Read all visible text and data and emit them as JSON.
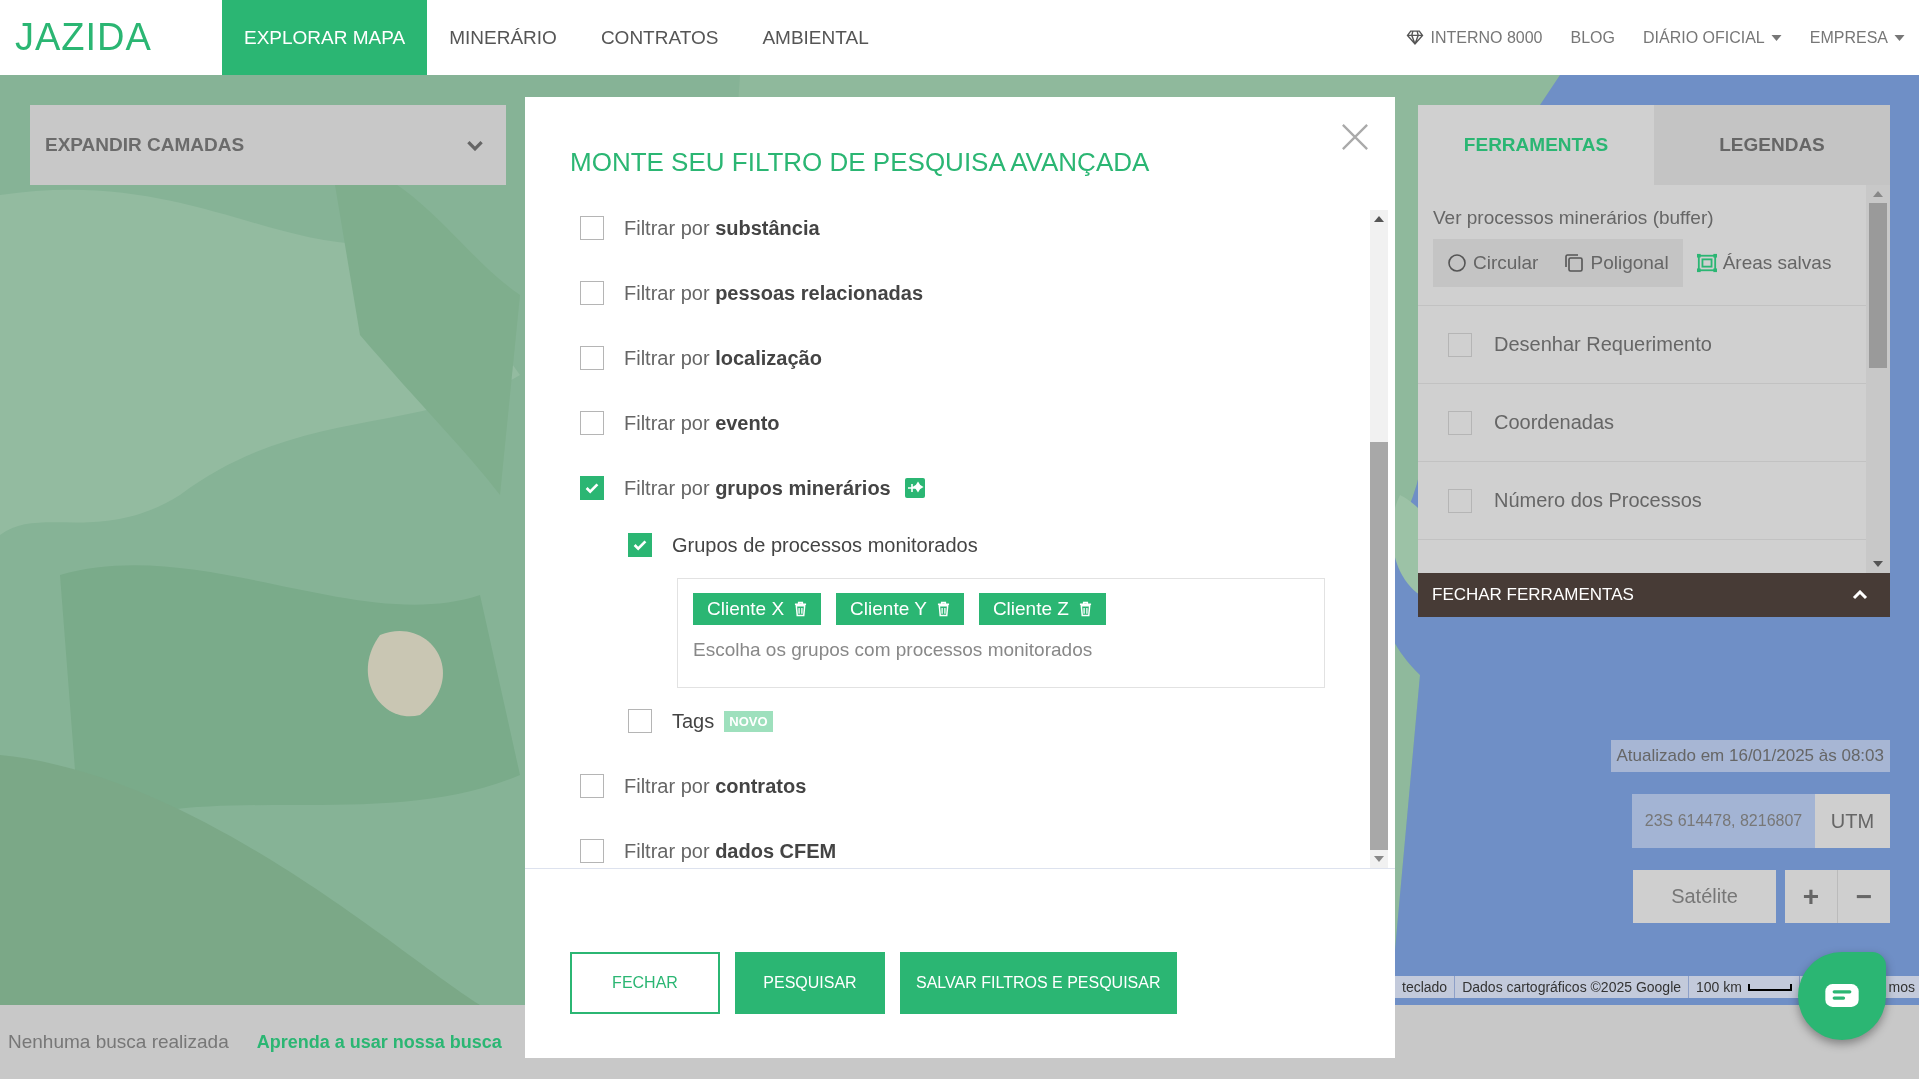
{
  "nav": {
    "logo": "JAZIDA",
    "tabs": [
      {
        "label": "EXPLORAR MAPA",
        "selected": true
      },
      {
        "label": "MINERÁRIO",
        "selected": false
      },
      {
        "label": "CONTRATOS",
        "selected": false
      },
      {
        "label": "AMBIENTAL",
        "selected": false
      }
    ],
    "links": [
      {
        "label": "INTERNO 8000",
        "kind": "plan"
      },
      {
        "label": "BLOG",
        "kind": "link"
      },
      {
        "label": "DIÁRIO OFICIAL",
        "kind": "dropdown"
      },
      {
        "label": "EMPRESA",
        "kind": "dropdown"
      }
    ]
  },
  "layers_panel": {
    "label": "EXPANDIR CAMADAS"
  },
  "tools_panel": {
    "tabs": [
      {
        "label": "FERRAMENTAS",
        "selected": true
      },
      {
        "label": "LEGENDAS",
        "selected": false
      }
    ],
    "heading": "Ver processos minerários (buffer)",
    "buffer_options": [
      {
        "label": "Circular",
        "kind": "circle"
      },
      {
        "label": "Poligonal",
        "kind": "polygon"
      },
      {
        "label": "Áreas salvas",
        "kind": "saved"
      }
    ],
    "options": [
      {
        "label": "Desenhar Requerimento",
        "checked": false
      },
      {
        "label": "Coordenadas",
        "checked": false
      },
      {
        "label": "Número dos Processos",
        "checked": false
      }
    ],
    "footer": "FECHAR FERRAMENTAS"
  },
  "map_controls": {
    "updated": "Atualizado em 16/01/2025 às 08:03",
    "coordinates": "23S 614478, 8216807",
    "coord_system": "UTM",
    "map_type": "Satélite",
    "zoom_in": "+",
    "zoom_out": "−"
  },
  "attribution": [
    {
      "label": "teclado",
      "kind": "text"
    },
    {
      "label": "Dados cartográficos ©2025 Google",
      "kind": "text"
    },
    {
      "label": "100 km",
      "kind": "scale"
    },
    {
      "label": "mos",
      "kind": "text"
    }
  ],
  "status_bar": {
    "message": "Nenhuma busca realizada",
    "help_link": "Aprenda a usar nossa busca"
  },
  "modal": {
    "title": "MONTE SEU FILTRO DE PESQUISA AVANÇADA",
    "filters": [
      {
        "label": "Filtrar por **substância**",
        "checked": false,
        "add_icon": false
      },
      {
        "label": "Filtrar por **pessoas relacionadas**",
        "checked": false,
        "add_icon": false
      },
      {
        "label": "Filtrar por **localização**",
        "checked": false,
        "add_icon": false
      },
      {
        "label": "Filtrar por **evento**",
        "checked": false,
        "add_icon": false
      },
      {
        "label": "Filtrar por **grupos minerários**",
        "checked": true,
        "add_icon": true,
        "children": [
          {
            "label": "Grupos de processos monitorados",
            "checked": true,
            "chips": [
              "Cliente X",
              "Cliente Y",
              "Cliente Z"
            ],
            "placeholder": "Escolha os grupos com processos monitorados"
          },
          {
            "label": "Tags",
            "checked": false,
            "tag": "NOVO"
          }
        ]
      },
      {
        "label": "Filtrar por **contratos**",
        "checked": false,
        "add_icon": false
      },
      {
        "label": "Filtrar por **dados CFEM**",
        "checked": false,
        "add_icon": false
      }
    ],
    "buttons": [
      {
        "label": "FECHAR",
        "kind": "outline"
      },
      {
        "label": "PESQUISAR",
        "kind": "primary"
      },
      {
        "label": "SALVAR FILTROS E PESQUISAR",
        "kind": "primary"
      }
    ]
  }
}
